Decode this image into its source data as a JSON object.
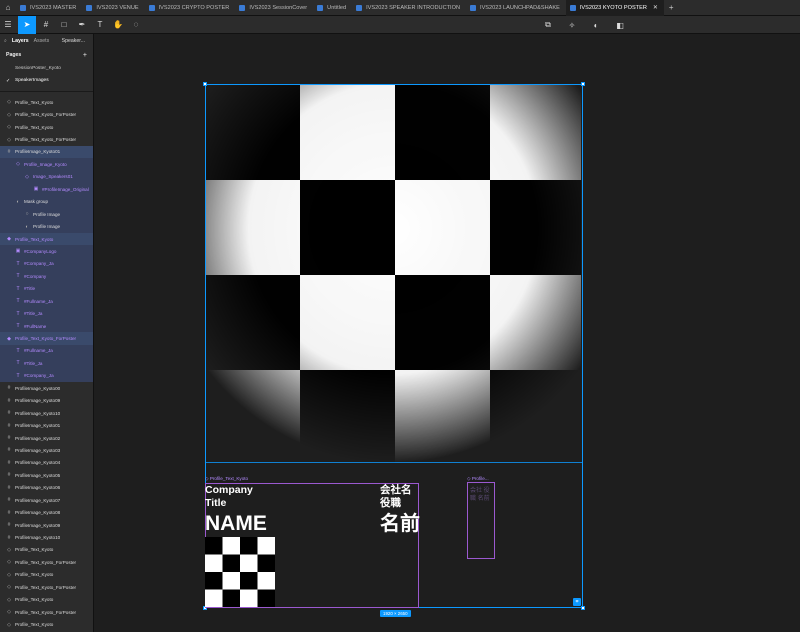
{
  "tabs": [
    {
      "label": "IVS2023 MASTER",
      "active": false
    },
    {
      "label": "IVS2023 VENUE",
      "active": false
    },
    {
      "label": "IVS2023 CRYPTO POSTER",
      "active": false
    },
    {
      "label": "IVS2023 SessionCover",
      "active": false
    },
    {
      "label": "Untitled",
      "active": false
    },
    {
      "label": "IVS2023 SPEAKER INTRODUCTION",
      "active": false
    },
    {
      "label": "IVS2023 LAUNCHPAD&SHAKE",
      "active": false
    },
    {
      "label": "IVS2023 KYOTO POSTER",
      "active": true
    }
  ],
  "tab_close": "✕",
  "tab_add": "+",
  "colors": {
    "accent": "#0d99ff",
    "component": "#b38aff",
    "selection": "#3a4a6b"
  },
  "left_panel": {
    "tab_layers": "Layers",
    "tab_assets": "Assets",
    "page_dropdown": "Speaker...",
    "pages_title": "Pages",
    "pages_add": "+",
    "pages": [
      {
        "label": "SessionPoster_Kyoto",
        "current": false
      },
      {
        "label": "SpeakerImages",
        "current": true
      }
    ],
    "layers": [
      {
        "label": "Profile_Text_Kyoto",
        "icon": "◇",
        "indent": 0,
        "style": ""
      },
      {
        "label": "Profile_Text_Kyoto_ForPoster",
        "icon": "◇",
        "indent": 0,
        "style": ""
      },
      {
        "label": "Profile_Text_Kyoto",
        "icon": "◇",
        "indent": 0,
        "style": ""
      },
      {
        "label": "Profile_Text_Kyoto_ForPoster",
        "icon": "◇",
        "indent": 0,
        "style": ""
      },
      {
        "label": "ProfileImage_Kyoto01",
        "icon": "#",
        "indent": 0,
        "style": "sel"
      },
      {
        "label": "Profile_Image_Kyoto",
        "icon": "◇",
        "indent": 1,
        "style": "selchild purple"
      },
      {
        "label": "Image_Speakers01",
        "icon": "◇",
        "indent": 2,
        "style": "selchild purple"
      },
      {
        "label": "#ProfileImage_Original",
        "icon": "▣",
        "indent": 3,
        "style": "selchild purple"
      },
      {
        "label": "Mask group",
        "icon": "◐",
        "indent": 1,
        "style": "selchild"
      },
      {
        "label": "Profile Image",
        "icon": "○",
        "indent": 2,
        "style": "selchild"
      },
      {
        "label": "Profile Image",
        "icon": "◐",
        "indent": 2,
        "style": "selchild"
      },
      {
        "label": "Profile_Text_Kyoto",
        "icon": "◆",
        "indent": 0,
        "style": "sel purple"
      },
      {
        "label": "#CompanyLogo",
        "icon": "▣",
        "indent": 1,
        "style": "selchild purple"
      },
      {
        "label": "#Company_Ja",
        "icon": "T",
        "indent": 1,
        "style": "selchild purple"
      },
      {
        "label": "#Company",
        "icon": "T",
        "indent": 1,
        "style": "selchild purple"
      },
      {
        "label": "#Title",
        "icon": "T",
        "indent": 1,
        "style": "selchild purple"
      },
      {
        "label": "#Fullname_Ja",
        "icon": "T",
        "indent": 1,
        "style": "selchild purple"
      },
      {
        "label": "#Title_Ja",
        "icon": "T",
        "indent": 1,
        "style": "selchild purple"
      },
      {
        "label": "#FullName",
        "icon": "T",
        "indent": 1,
        "style": "selchild purple"
      },
      {
        "label": "Profile_Text_Kyoto_ForPoster",
        "icon": "◆",
        "indent": 0,
        "style": "sel purple"
      },
      {
        "label": "#Fullname_Ja",
        "icon": "T",
        "indent": 1,
        "style": "selchild purple"
      },
      {
        "label": "#Title_Ja",
        "icon": "T",
        "indent": 1,
        "style": "selchild purple"
      },
      {
        "label": "#Company_Ja",
        "icon": "T",
        "indent": 1,
        "style": "selchild purple"
      },
      {
        "label": "ProfileImage_Kyoto00",
        "icon": "#",
        "indent": 0,
        "style": ""
      },
      {
        "label": "ProfileImage_Kyoto09",
        "icon": "#",
        "indent": 0,
        "style": ""
      },
      {
        "label": "ProfileImage_Kyoto10",
        "icon": "#",
        "indent": 0,
        "style": ""
      },
      {
        "label": "ProfileImage_Kyoto01",
        "icon": "#",
        "indent": 0,
        "style": ""
      },
      {
        "label": "ProfileImage_Kyoto02",
        "icon": "#",
        "indent": 0,
        "style": ""
      },
      {
        "label": "ProfileImage_Kyoto03",
        "icon": "#",
        "indent": 0,
        "style": ""
      },
      {
        "label": "ProfileImage_Kyoto04",
        "icon": "#",
        "indent": 0,
        "style": ""
      },
      {
        "label": "ProfileImage_Kyoto05",
        "icon": "#",
        "indent": 0,
        "style": ""
      },
      {
        "label": "ProfileImage_Kyoto06",
        "icon": "#",
        "indent": 0,
        "style": ""
      },
      {
        "label": "ProfileImage_Kyoto07",
        "icon": "#",
        "indent": 0,
        "style": ""
      },
      {
        "label": "ProfileImage_Kyoto08",
        "icon": "#",
        "indent": 0,
        "style": ""
      },
      {
        "label": "ProfileImage_Kyoto09",
        "icon": "#",
        "indent": 0,
        "style": ""
      },
      {
        "label": "ProfileImage_Kyoto10",
        "icon": "#",
        "indent": 0,
        "style": ""
      },
      {
        "label": "Profile_Text_Kyoto",
        "icon": "◇",
        "indent": 0,
        "style": ""
      },
      {
        "label": "Profile_Text_Kyoto_ForPoster",
        "icon": "◇",
        "indent": 0,
        "style": ""
      },
      {
        "label": "Profile_Text_Kyoto",
        "icon": "◇",
        "indent": 0,
        "style": ""
      },
      {
        "label": "Profile_Text_Kyoto_ForPoster",
        "icon": "◇",
        "indent": 0,
        "style": ""
      },
      {
        "label": "Profile_Text_Kyoto",
        "icon": "◇",
        "indent": 0,
        "style": ""
      },
      {
        "label": "Profile_Text_Kyoto_ForPoster",
        "icon": "◇",
        "indent": 0,
        "style": ""
      },
      {
        "label": "Profile_Text_Kyoto",
        "icon": "◇",
        "indent": 0,
        "style": ""
      }
    ]
  },
  "canvas": {
    "frame_label": "Profile_Text_Kyoto",
    "company": "Company",
    "title": "Title",
    "name": "NAME",
    "company_ja": "会社名",
    "title_ja": "役職",
    "name_ja": "名前",
    "poster_label": "Profile...",
    "poster_ghost": "会社 役職 名前",
    "dimensions": "1920 × 2650"
  }
}
